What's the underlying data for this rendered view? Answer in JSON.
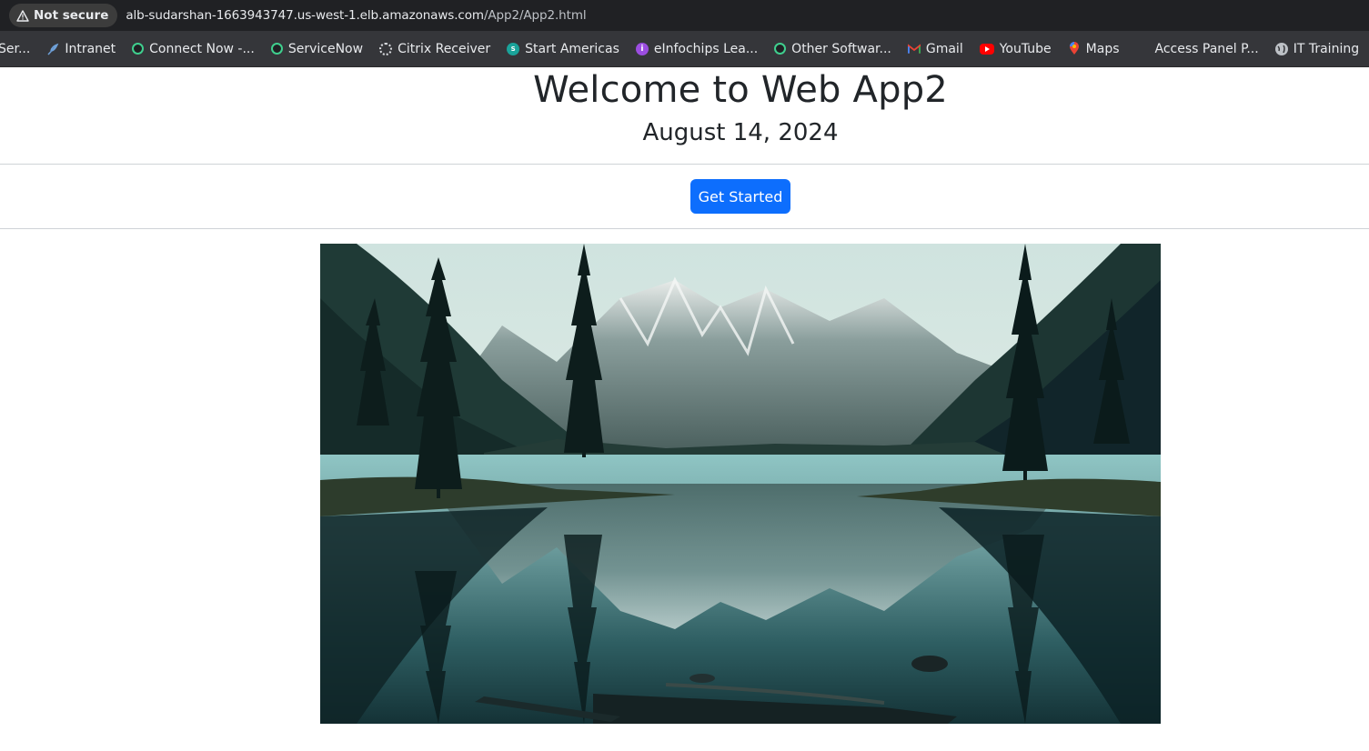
{
  "browser": {
    "security_label": "Not secure",
    "url_host": "alb-sudarshan-1663943747.us-west-1.elb.amazonaws.com",
    "url_path": "/App2/App2.html"
  },
  "bookmarks": [
    {
      "label": "Ser...",
      "icon": "page-icon"
    },
    {
      "label": "Intranet",
      "icon": "feather-icon"
    },
    {
      "label": "Connect Now -...",
      "icon": "servicenow-icon"
    },
    {
      "label": "ServiceNow",
      "icon": "servicenow-icon"
    },
    {
      "label": "Citrix Receiver",
      "icon": "citrix-icon"
    },
    {
      "label": "Start Americas",
      "icon": "sharepoint-icon"
    },
    {
      "label": "eInfochips Lea...",
      "icon": "einfochips-icon"
    },
    {
      "label": "Other Softwar...",
      "icon": "servicenow-icon"
    },
    {
      "label": "Gmail",
      "icon": "gmail-icon"
    },
    {
      "label": "YouTube",
      "icon": "youtube-icon"
    },
    {
      "label": "Maps",
      "icon": "maps-icon"
    },
    {
      "label": "Access Panel P...",
      "icon": "microsoft-icon"
    },
    {
      "label": "IT Training",
      "icon": "globe-icon"
    }
  ],
  "page": {
    "title": "Welcome to Web App2",
    "date": "August 14, 2024",
    "cta_label": "Get Started",
    "hero_image": "mountain-lake-landscape"
  },
  "colors": {
    "accent": "#0d6efd",
    "text": "#212529",
    "chrome_dark": "#202124",
    "bookmarks_bar": "#35363a"
  }
}
